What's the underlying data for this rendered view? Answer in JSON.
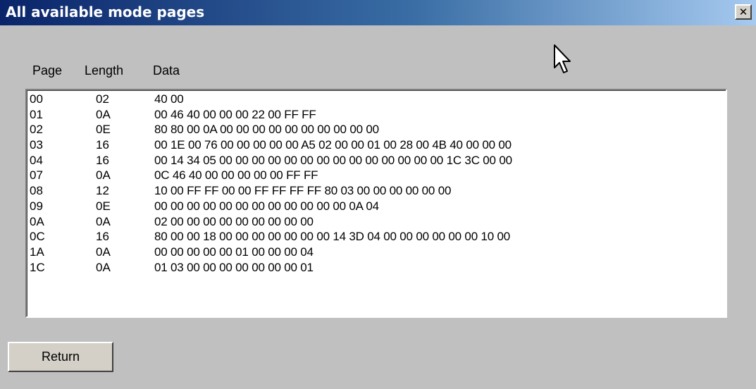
{
  "window": {
    "title": "All available mode pages",
    "close_glyph": "✕"
  },
  "list": {
    "headers": {
      "page": "Page",
      "length": "Length",
      "data": "Data"
    },
    "rows": [
      {
        "page": "00",
        "length": "02",
        "data": "40 00"
      },
      {
        "page": "01",
        "length": "0A",
        "data": "00 46 40 00 00 00 22 00 FF FF"
      },
      {
        "page": "02",
        "length": "0E",
        "data": "80 80 00 0A 00 00 00 00 00 00 00 00 00 00"
      },
      {
        "page": "03",
        "length": "16",
        "data": "00 1E 00 76 00 00 00 00 00 A5 02 00 00 01 00 28 00 4B 40 00 00 00"
      },
      {
        "page": "04",
        "length": "16",
        "data": "00 14 34 05 00 00 00 00 00 00 00 00 00 00 00 00 00 00 1C 3C 00 00"
      },
      {
        "page": "07",
        "length": "0A",
        "data": "0C 46 40 00 00 00 00 00 FF FF"
      },
      {
        "page": "08",
        "length": "12",
        "data": "10 00 FF FF 00 00 FF FF FF FF 80 03 00 00 00 00 00 00"
      },
      {
        "page": "09",
        "length": "0E",
        "data": "00 00 00 00 00 00 00 00 00 00 00 00 0A 04"
      },
      {
        "page": "0A",
        "length": "0A",
        "data": "02 00 00 00 00 00 00 00 00 00"
      },
      {
        "page": "0C",
        "length": "16",
        "data": "80 00 00 18 00 00 00 00 00 00 00 14 3D 04 00 00 00 00 00 00 10 00"
      },
      {
        "page": "1A",
        "length": "0A",
        "data": "00 00 00 00 00 01 00 00 00 04"
      },
      {
        "page": "1C",
        "length": "0A",
        "data": "01 03 00 00 00 00 00 00 00 01"
      }
    ]
  },
  "buttons": {
    "return_label": "Return"
  },
  "icons": {
    "close": "close-icon",
    "cursor": "mouse-pointer-icon"
  },
  "colors": {
    "title_start": "#0a246a",
    "title_end": "#a6caf0",
    "window_bg": "#c0c0c0",
    "list_bg": "#ffffff"
  }
}
